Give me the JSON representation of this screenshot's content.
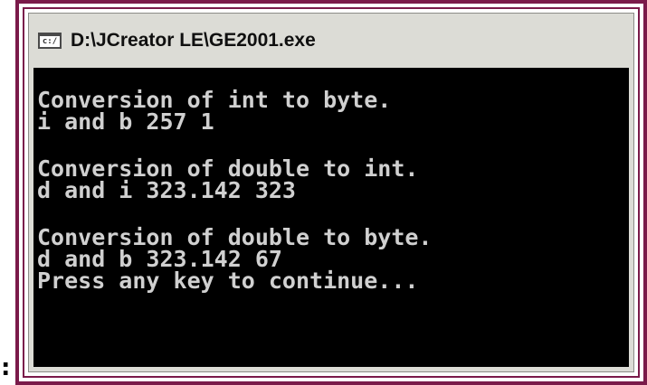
{
  "page": {
    "leading_colon": ":"
  },
  "window": {
    "title": "D:\\JCreator LE\\GE2001.exe",
    "icon": "console-window-icon",
    "icon_glyph": "c:/"
  },
  "console": {
    "lines": [
      "Conversion of int to byte.",
      "i and b 257 1",
      "Conversion of double to int.",
      "d and i 323.142 323",
      "Conversion of double to byte.",
      "d and b 323.142 67",
      "Press any key to continue..."
    ]
  },
  "colors": {
    "frame_border": "#7a1a4a",
    "console_background": "#000000",
    "console_text": "#d0d0d0",
    "title_bar": "#dcdcd6"
  }
}
